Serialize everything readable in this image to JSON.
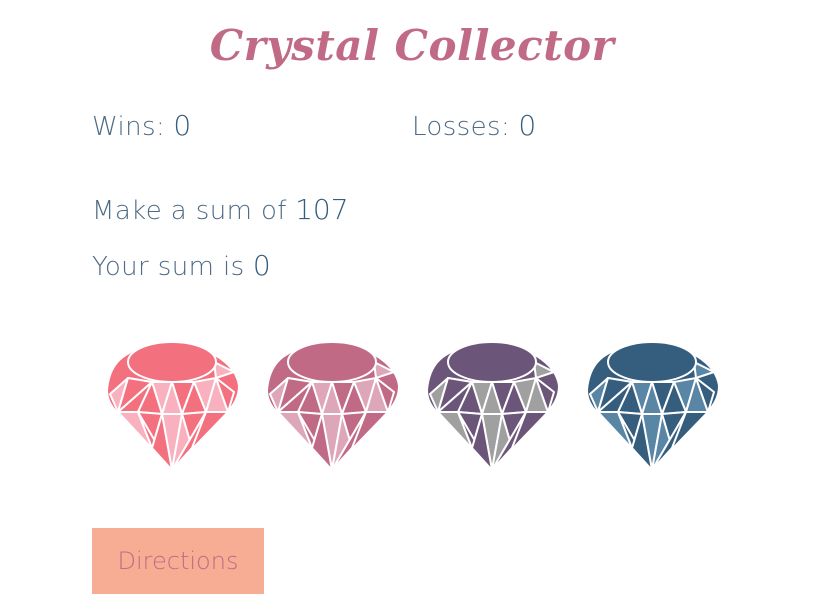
{
  "title": "Crystal Collector",
  "scores": {
    "wins_label": "Wins:",
    "wins_value": "0",
    "losses_label": "Losses:",
    "losses_value": "0"
  },
  "game": {
    "target_label": "Make a sum of",
    "target_value": "107",
    "sum_label": "Your sum is",
    "sum_value": "0"
  },
  "crystals": [
    {
      "name": "crystal-1",
      "dark": "#f3707f",
      "light": "#f9b1bf"
    },
    {
      "name": "crystal-2",
      "dark": "#c06a86",
      "light": "#dea7b9"
    },
    {
      "name": "crystal-3",
      "dark": "#6b567a",
      "light": "#a0a0a0"
    },
    {
      "name": "crystal-4",
      "dark": "#355d7d",
      "light": "#5a86a6"
    }
  ],
  "directions_button": {
    "label": "Directions"
  },
  "colors": {
    "title": "#c06a86",
    "label_text": "#4e6a86",
    "value_text": "#355d7d",
    "button_bg": "#f7ad93",
    "button_text": "#c06a86"
  }
}
